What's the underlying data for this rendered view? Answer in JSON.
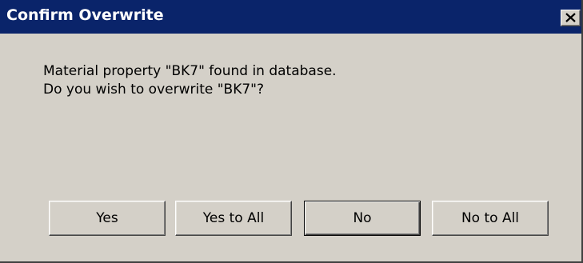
{
  "window": {
    "title": "Confirm Overwrite",
    "close_icon": "close-icon"
  },
  "message": {
    "line1": "Material property \"BK7\" found in database.",
    "line2": "Do you wish to overwrite \"BK7\"?"
  },
  "buttons": {
    "yes": "Yes",
    "yes_to_all": "Yes to All",
    "no": "No",
    "no_to_all": "No to All"
  },
  "colors": {
    "titlebar": "#0a246a",
    "dialog_bg": "#d4d0c8",
    "title_text": "#ffffff"
  }
}
